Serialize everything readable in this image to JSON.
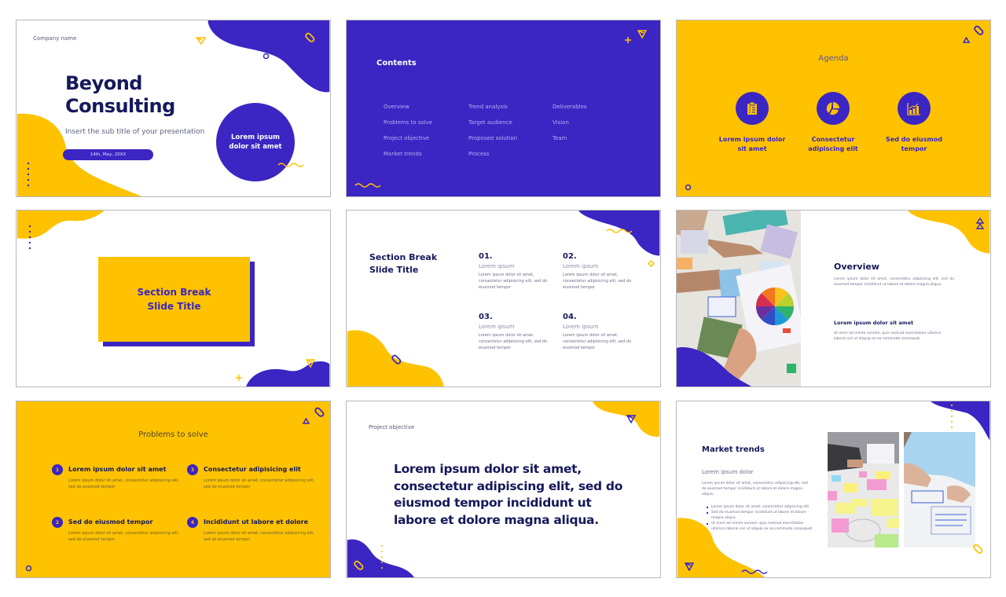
{
  "theme": {
    "purple": "#3b25c3",
    "yellow": "#fec200",
    "navy": "#15185a",
    "white": "#ffffff"
  },
  "slides": [
    {
      "index": 1,
      "layout": "title",
      "company": "Company name",
      "title_line1": "Beyond",
      "title_line2": "Consulting",
      "subtitle": "Insert the sub title of your presentation",
      "date": "14th, May, 20XX",
      "circle_text_line1": "Lorem ipsum",
      "circle_text_line2": "dolor sit amet",
      "icons": [
        "paper-plane-icon",
        "link-icon",
        "ring-icon",
        "squiggle-icon",
        "dots-icon"
      ]
    },
    {
      "index": 2,
      "layout": "contents",
      "heading": "Contents",
      "columns": [
        [
          "Overview",
          "Problems to solve",
          "Project objective",
          "Market trends"
        ],
        [
          "Trend analysis",
          "Target audience",
          "Proposed solution",
          "Process"
        ],
        [
          "Deliverables",
          "Vision",
          "Team"
        ]
      ],
      "icons": [
        "plus-icon",
        "paper-plane-icon",
        "squiggle-icon"
      ]
    },
    {
      "index": 3,
      "layout": "agenda",
      "heading": "Agenda",
      "items": [
        {
          "icon": "clipboard-checklist-icon",
          "line1": "Lorem ipsum dolor",
          "line2": "sit amet"
        },
        {
          "icon": "pie-chart-icon",
          "line1": "Consectetur",
          "line2": "adipiscing elit"
        },
        {
          "icon": "bar-chart-growth-icon",
          "line1": "Sed do eiusmod",
          "line2": "tempor"
        }
      ],
      "icons": [
        "triangle-icon",
        "link-icon",
        "ring-icon"
      ]
    },
    {
      "index": 4,
      "layout": "section-break",
      "title_line1": "Section Break",
      "title_line2": "Slide Title",
      "icons": [
        "dots-icon",
        "paper-plane-icon",
        "plus-icon"
      ]
    },
    {
      "index": 5,
      "layout": "section-break-numbered",
      "title_line1": "Section Break",
      "title_line2": "Slide Title",
      "cells": [
        {
          "num": "01.",
          "title": "Lorem ipsum",
          "body": "Lorem ipsum dolor sit amet, consectetur adipisicing elit, sed do eiusmod tempor"
        },
        {
          "num": "02.",
          "title": "Lorem ipsum",
          "body": "Lorem ipsum dolor sit amet, consectetur adipisicing elit, sed do eiusmod tempor"
        },
        {
          "num": "03.",
          "title": "Lorem ipsum",
          "body": "Lorem ipsum dolor sit amet, consectetur adipisicing elit, sed do eiusmod tempor"
        },
        {
          "num": "04.",
          "title": "Lorem ipsum",
          "body": "Lorem ipsum dolor sit amet, consectetur adipisicing elit, sed do eiusmod tempor"
        }
      ],
      "icons": [
        "squiggle-icon",
        "diamond-icon",
        "link-icon"
      ]
    },
    {
      "index": 6,
      "layout": "overview",
      "photo": "designers-color-wheel-photo",
      "title": "Overview",
      "body": "Lorem ipsum dolor sit amet, consectetur adipiscing elit, sed do eiusmod tempor incididunt ut labore et dolore magna aliqua.",
      "subtitle": "Lorem ipsum dolor sit amet",
      "body2": "Ut enim ad minim veniam, quis nostrud exercitation ullamco laboris nisi ut aliquip ex ea commodo consequat.",
      "icons": [
        "double-triangle-icon"
      ]
    },
    {
      "index": 7,
      "layout": "problems",
      "heading": "Problems to solve",
      "points": [
        {
          "badge": "1",
          "title": "Lorem ipsum dolor sit amet",
          "body": "Lorem ipsum dolor sit amet, consectetur adipisicing elit, sed do eiusmod tempor"
        },
        {
          "badge": "2",
          "title": "Sed do eiusmod tempor",
          "body": "Lorem ipsum dolor sit amet, consectetur adipisicing elit, sed do eiusmod tempor"
        },
        {
          "badge": "3",
          "title": "Consectetur adipisicing elit",
          "body": "Lorem ipsum dolor sit amet, consectetur adipisicing elit, sed do eiusmod tempor"
        },
        {
          "badge": "4",
          "title": "Incididunt ut labore et dolore",
          "body": "Lorem ipsum dolor sit amet, consectetur adipisicing elit, sed do eiusmod tempor"
        }
      ],
      "icons": [
        "triangle-icon",
        "link-icon",
        "ring-icon"
      ]
    },
    {
      "index": 8,
      "layout": "quote",
      "label": "Project objective",
      "quote": "Lorem ipsum dolor sit amet, consectetur adipiscing elit, sed do eiusmod tempor incididunt ut labore et dolore magna aliqua.",
      "icons": [
        "paper-plane-icon",
        "link-icon",
        "dots-icon"
      ]
    },
    {
      "index": 9,
      "layout": "market-trends",
      "title": "Market trends",
      "subtitle": "Lorem ipsum dolor",
      "body": "Lorem ipsum dolor sit amet, consectetur adipiscing elit, sed do eiusmod tempor incididunt ut labore et dolore magna aliqua.",
      "bullets": [
        "Lorem ipsum dolor sit amet, consectetur adipiscing elit",
        "Sed do eiusmod tempor incididunt ut labore et dolore magna aliqua",
        "Ut enim ad minim veniam, quis nostrud exercitation ullamco laboris nisi ut aliquip ex ea commodo consequat"
      ],
      "photos": [
        "sticky-notes-planning-photo",
        "wireframe-sketching-photo"
      ],
      "icons": [
        "dots-icon",
        "link-icon",
        "paper-plane-icon",
        "squiggle-icon"
      ]
    }
  ]
}
